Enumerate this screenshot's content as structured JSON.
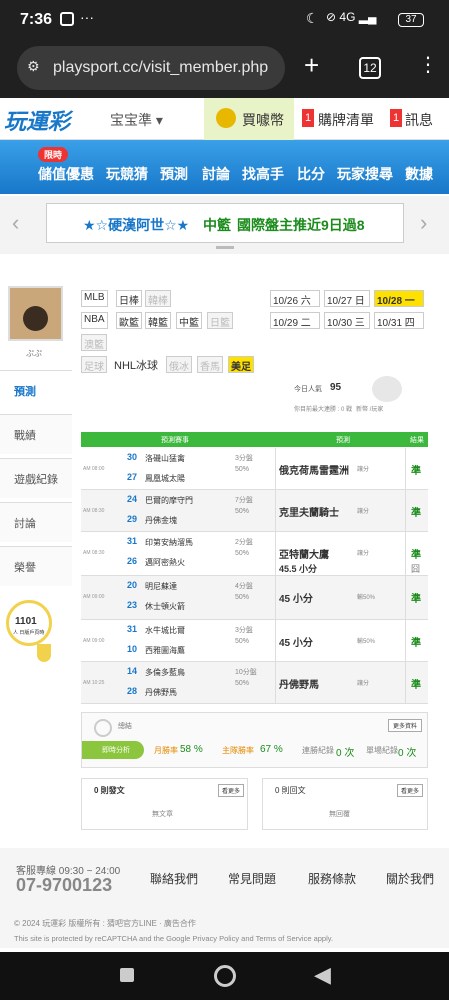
{
  "status": {
    "time": "7:36",
    "battery": "37"
  },
  "browser": {
    "url": "playsport.cc/visit_member.php",
    "tabs": "12"
  },
  "header": {
    "logo": "玩運彩",
    "user": "宝宝準",
    "buy": "買噱幣",
    "cart_count": "1",
    "cart": "購牌清單",
    "msg_count": "1",
    "msg": "訊息"
  },
  "nav": {
    "badge": "限時",
    "items": [
      "儲值優惠",
      "玩競猜",
      "預測",
      "討論",
      "找高手",
      "比分",
      "玩家搜尋",
      "數據"
    ]
  },
  "banner": {
    "text1": "★☆硬漢阿世☆★",
    "text2": "中籃",
    "text3": "國際盤主推近9日過8"
  },
  "sidebar": {
    "username": "ぷぷ",
    "tabs": [
      "預測",
      "戰績",
      "遊戲紀錄",
      "討論",
      "榮譽"
    ],
    "badge_num": "1101",
    "badge_label": "人 日版戶頁時"
  },
  "leagues": {
    "row1": [
      "MLB",
      "日棒",
      "韓棒"
    ],
    "row2": [
      "NBA",
      "歐籃",
      "韓籃",
      "中籃",
      "日籃"
    ],
    "row3": [
      "澳籃"
    ],
    "row4": [
      "足球",
      "NHL冰球",
      "俄冰",
      "香馬",
      "美足"
    ]
  },
  "dates": {
    "row1": [
      "10/26 六",
      "10/27 日",
      "10/28 一"
    ],
    "row2": [
      "10/29 二",
      "10/30 三",
      "10/31 四"
    ]
  },
  "stats": {
    "popularity_label": "今日人氣",
    "popularity": "95",
    "note": "你目前最大連勝 : 0 戰",
    "sub": "新幣 /玩家"
  },
  "table": {
    "head": [
      "預測賽事",
      "預測",
      "結果"
    ],
    "rows": [
      {
        "time": "AM 08:00",
        "n1": "30",
        "t1": "洛磯山猛禽",
        "n2": "27",
        "t2": "鳳凰城太陽",
        "spread": "3分盤",
        "pct": "50%",
        "pick": "俄克荷馬雷霆洲",
        "pick_sub": "讓分",
        "res": "準"
      },
      {
        "time": "AM 08:30",
        "n1": "24",
        "t1": "巴爾的摩守門",
        "n2": "29",
        "t2": "丹佛金塊",
        "spread": "7分盤",
        "pct": "50%",
        "pick": "克里夫蘭騎士",
        "pick_sub": "讓分",
        "res": "準"
      },
      {
        "time": "AM 08:30",
        "n1": "31",
        "t1": "印第安納溜馬",
        "n2": "26",
        "t2": "邁阿密熱火",
        "spread": "2分盤",
        "pct": "50%",
        "pick": "亞特蘭大鷹",
        "pick_sub": "讓分",
        "pick2": "45.5 小分",
        "res": "準",
        "res2": "囧"
      },
      {
        "time": "AM 09:00",
        "n1": "20",
        "t1": "明尼蘇達",
        "n2": "23",
        "t2": "休士頓火箭",
        "spread": "4分盤",
        "pct": "50%",
        "pick": "45 小分",
        "pick_sub": "輸50%",
        "res": "準"
      },
      {
        "time": "AM 09:00",
        "n1": "31",
        "t1": "水牛城比爾",
        "n2": "10",
        "t2": "西雅圖海鷹",
        "spread": "3分盤",
        "pct": "50%",
        "pick": "45 小分",
        "pick_sub": "輸50%",
        "res": "準"
      },
      {
        "time": "AM 10:25",
        "n1": "14",
        "t1": "多倫多藍鳥",
        "n2": "28",
        "t2": "丹佛野馬",
        "spread": "10分盤",
        "pct": "50%",
        "pick": "丹佛野馬",
        "pick_sub": "讓分",
        "res": "準"
      }
    ]
  },
  "summary": {
    "label": "總結",
    "pill": "即時分析",
    "month": "月勝率",
    "month_val": "58 %",
    "win": "主隊勝率",
    "win_val": "67 %",
    "streak": "連勝紀錄",
    "streak_val": "0 次",
    "lose": "單場紀錄",
    "lose_val": "0 次",
    "btn": "更多資料"
  },
  "posts": {
    "left_title": "0 則發文",
    "left_btn": "看更多",
    "left_empty": "無文章",
    "right_title": "0 則回文",
    "right_btn": "看更多",
    "right_empty": "無回覆"
  },
  "footer": {
    "hours": "客服專線 09:30 ~ 24:00",
    "phone": "07-9700123",
    "links": [
      "聯絡我們",
      "常見問題",
      "服務條款",
      "關於我們"
    ],
    "copy": "© 2024 玩運彩 版權所有 : 猜吧官方LINE · 廣告合作",
    "recaptcha": "This site is protected by reCAPTCHA and the Google Privacy Policy and Terms of Service apply."
  },
  "colors": {
    "accent": "#1877c9",
    "green": "#1c8c1c",
    "highlight": "#ffe100"
  }
}
